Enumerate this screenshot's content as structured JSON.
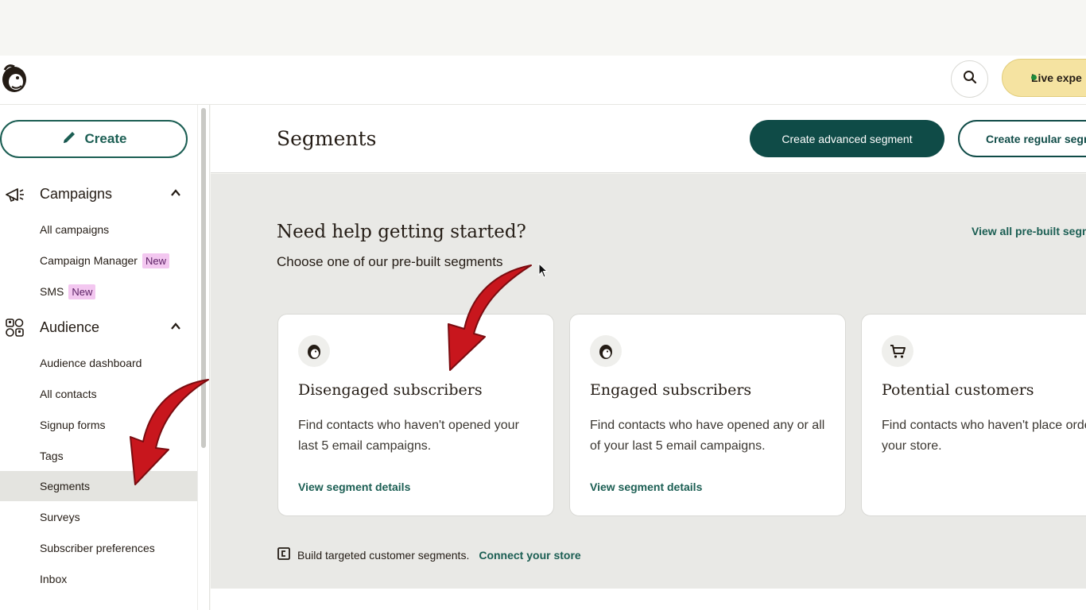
{
  "header": {
    "live_label": "Live expe",
    "icons": {
      "logo": "mailchimp-freddie-logo",
      "search": "search-icon"
    }
  },
  "sidebar": {
    "create_label": "Create",
    "sections": [
      {
        "label": "Campaigns",
        "icon": "megaphone-icon",
        "items": [
          {
            "label": "All campaigns"
          },
          {
            "label": "Campaign Manager",
            "badge": "New"
          },
          {
            "label": "SMS",
            "badge": "New"
          }
        ]
      },
      {
        "label": "Audience",
        "icon": "audience-icon",
        "items": [
          {
            "label": "Audience dashboard"
          },
          {
            "label": "All contacts"
          },
          {
            "label": "Signup forms"
          },
          {
            "label": "Tags"
          },
          {
            "label": "Segments",
            "active": true
          },
          {
            "label": "Surveys"
          },
          {
            "label": "Subscriber preferences"
          },
          {
            "label": "Inbox"
          }
        ]
      }
    ]
  },
  "page": {
    "title": "Segments",
    "btn_advanced": "Create advanced segment",
    "btn_regular": "Create regular segm"
  },
  "help": {
    "title": "Need help getting started?",
    "subtitle": "Choose one of our pre-built segments",
    "view_all": "View all pre-built segm"
  },
  "cards": [
    {
      "title": "Disengaged subscribers",
      "desc": "Find contacts who haven't opened your last 5 email campaigns.",
      "link": "View segment details",
      "icon": "freddie-icon"
    },
    {
      "title": "Engaged subscribers",
      "desc": "Find contacts who have opened any or all of your last 5 email campaigns.",
      "link": "View segment details",
      "icon": "freddie-icon"
    },
    {
      "title": "Potential customers",
      "desc": "Find contacts who haven't place order in your store.",
      "link": "",
      "icon": "cart-icon"
    }
  ],
  "store": {
    "text": "Build targeted customer segments.",
    "link": "Connect your store",
    "icon": "store-icon"
  },
  "colors": {
    "brand_dark": "#0f4b47",
    "link_green": "#1b5e53",
    "live_pill": "#f5e3a1",
    "badge_new": "#f3c7f0",
    "annotation_arrow": "#c8161d"
  }
}
